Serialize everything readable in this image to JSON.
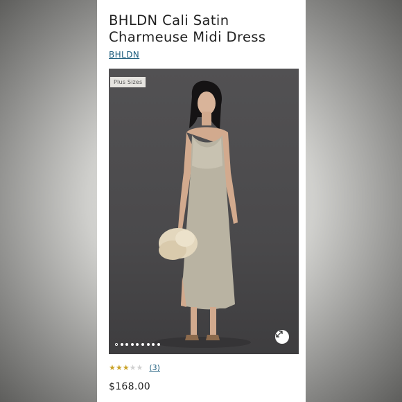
{
  "product": {
    "title": "BHLDN Cali Satin Charmeuse Midi Dress",
    "brand": "BHLDN",
    "badge": "Plus Sizes",
    "image_count": 9,
    "active_image_index": 0,
    "rating": 3,
    "rating_max": 5,
    "review_count": "(3)",
    "price": "$168.00"
  },
  "icons": {
    "expand": "expand-icon",
    "star": "star-icon"
  },
  "colors": {
    "link": "#1f5e7e",
    "star_filled": "#c9a227",
    "star_empty": "#d0d0d0",
    "photo_background": "#4a494b"
  }
}
